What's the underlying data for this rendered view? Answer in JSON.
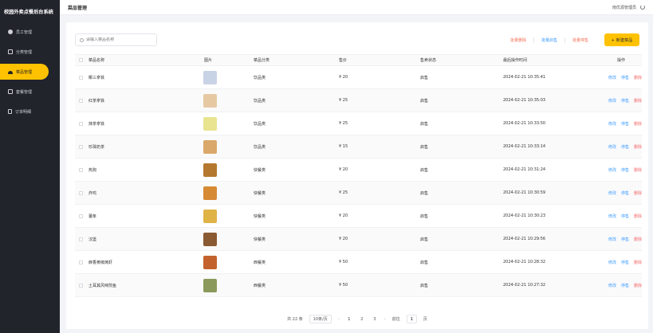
{
  "sidebar": {
    "brand": "校园外卖点餐后台系统",
    "items": [
      {
        "label": "员工管理",
        "icon": "user-icon",
        "active": false
      },
      {
        "label": "分类管理",
        "icon": "category-icon",
        "active": false
      },
      {
        "label": "菜品管理",
        "icon": "dish-icon",
        "active": true
      },
      {
        "label": "套餐管理",
        "icon": "combo-icon",
        "active": false
      },
      {
        "label": "订单明细",
        "icon": "order-icon",
        "active": false
      }
    ]
  },
  "header": {
    "title": "菜品管理",
    "user": "南优源管理员"
  },
  "toolbar": {
    "search_placeholder": "请输入菜品名称",
    "batch_delete": "批量删除",
    "batch_enable": "批量启售",
    "batch_disable": "批量停售",
    "add": "+ 新建菜品"
  },
  "table": {
    "columns": {
      "name": "菜品名称",
      "image": "图片",
      "category": "菜品分类",
      "price": "售价",
      "status": "售卖状态",
      "time": "最后操作时间",
      "ops": "操作"
    },
    "op_labels": {
      "edit": "修改",
      "toggle": "停售",
      "delete": "删除"
    },
    "rows": [
      {
        "name": "椰三拿铁",
        "category": "饮品类",
        "price": "¥ 20",
        "status": "启售",
        "time": "2024-02-21 10:35:41",
        "thumb": "#c9d3e6"
      },
      {
        "name": "红茶拿铁",
        "category": "饮品类",
        "price": "¥ 25",
        "status": "启售",
        "time": "2024-02-21 10:35:03",
        "thumb": "#e6c9a3"
      },
      {
        "name": "抹茶拿铁",
        "category": "饮品类",
        "price": "¥ 25",
        "status": "启售",
        "time": "2024-02-21 10:33:50",
        "thumb": "#e8e48f"
      },
      {
        "name": "珍珠奶茶",
        "category": "饮品类",
        "price": "¥ 15",
        "status": "启售",
        "time": "2024-02-21 10:33:14",
        "thumb": "#d9a86a"
      },
      {
        "name": "热狗",
        "category": "快餐类",
        "price": "¥ 20",
        "status": "启售",
        "time": "2024-02-21 10:31:24",
        "thumb": "#b5782f"
      },
      {
        "name": "炸鸡",
        "category": "快餐类",
        "price": "¥ 25",
        "status": "启售",
        "time": "2024-02-21 10:30:59",
        "thumb": "#d68a33"
      },
      {
        "name": "薯条",
        "category": "快餐类",
        "price": "¥ 20",
        "status": "启售",
        "time": "2024-02-21 10:30:23",
        "thumb": "#e0b347"
      },
      {
        "name": "汉堡",
        "category": "快餐类",
        "price": "¥ 20",
        "status": "启售",
        "time": "2024-02-21 10:29:56",
        "thumb": "#8a5a32"
      },
      {
        "name": "麻香黄椒烤虾",
        "category": "西餐类",
        "price": "¥ 50",
        "status": "启售",
        "time": "2024-02-21 10:28:32",
        "thumb": "#c4622e"
      },
      {
        "name": "土耳其风味煎鱼",
        "category": "西餐类",
        "price": "¥ 50",
        "status": "启售",
        "time": "2024-02-21 10:27:32",
        "thumb": "#8b9a5a"
      }
    ]
  },
  "pager": {
    "total": "共 22 条",
    "page_size": "10条/页",
    "prev": "‹",
    "next": "›",
    "pages": [
      "1",
      "2",
      "3"
    ],
    "current": "1",
    "jump_label": "前往",
    "jump_value": "1",
    "page_suffix": "页"
  }
}
